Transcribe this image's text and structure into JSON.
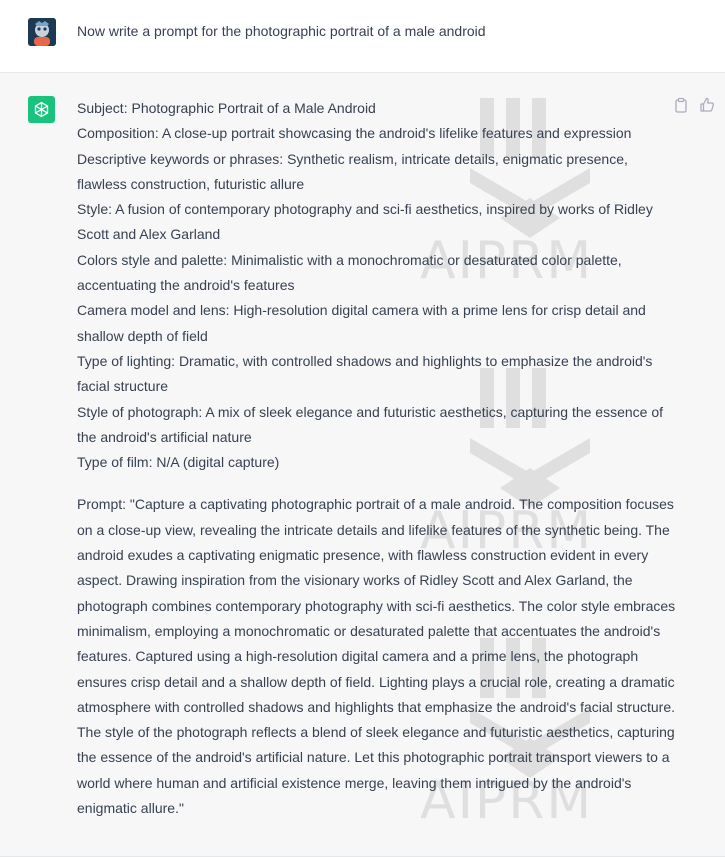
{
  "user_message": {
    "text": "Now write a prompt for the photographic portrait of a male android"
  },
  "assistant_message": {
    "lines": [
      "Subject: Photographic Portrait of a Male Android",
      "Composition: A close-up portrait showcasing the android's lifelike features and expression",
      "Descriptive keywords or phrases: Synthetic realism, intricate details, enigmatic presence, flawless construction, futuristic allure",
      "Style: A fusion of contemporary photography and sci-fi aesthetics, inspired by works of Ridley Scott and Alex Garland",
      "Colors style and palette: Minimalistic with a monochromatic or desaturated color palette, accentuating the android's features",
      "Camera model and lens: High-resolution digital camera with a prime lens for crisp detail and shallow depth of field",
      "Type of lighting: Dramatic, with controlled shadows and highlights to emphasize the android's facial structure",
      "Style of photograph: A mix of sleek elegance and futuristic aesthetics, capturing the essence of the android's artificial nature",
      "Type of film: N/A (digital capture)"
    ],
    "prompt": "Prompt: \"Capture a captivating photographic portrait of a male android. The composition focuses on a close-up view, revealing the intricate details and lifelike features of the synthetic being. The android exudes a captivating enigmatic presence, with flawless construction evident in every aspect. Drawing inspiration from the visionary works of Ridley Scott and Alex Garland, the photograph combines contemporary photography with sci-fi aesthetics. The color style embraces minimalism, employing a monochromatic or desaturated palette that accentuates the android's features. Captured using a high-resolution digital camera and a prime lens, the photograph ensures crisp detail and a shallow depth of field. Lighting plays a crucial role, creating a dramatic atmosphere with controlled shadows and highlights that emphasize the android's facial structure. The style of the photograph reflects a blend of sleek elegance and futuristic aesthetics, capturing the essence of the android's artificial nature. Let this photographic portrait transport viewers to a world where human and artificial existence merge, leaving them intrigued by the android's enigmatic allure.\""
  },
  "watermark": {
    "text": "AIPRM"
  },
  "icons": {
    "user_avatar": "user-avatar-image",
    "assistant_avatar": "openai-logo-icon",
    "copy": "clipboard-icon",
    "like": "thumbs-up-icon"
  },
  "colors": {
    "assistant_bg": "#f7f7f8",
    "openai_green": "#19c37d",
    "text": "#374151"
  }
}
